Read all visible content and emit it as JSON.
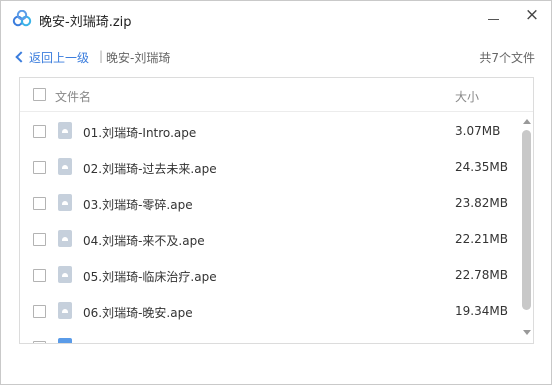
{
  "window": {
    "title": "晚安-刘瑞琦.zip",
    "close_glyph": "×"
  },
  "nav": {
    "back_label": "返回上一级",
    "separator": "|",
    "current_folder": "晚安-刘瑞琦",
    "file_count": "共7个文件"
  },
  "list": {
    "columns": {
      "name": "文件名",
      "size": "大小"
    },
    "files": [
      {
        "name": "01.刘瑞琦-Intro.ape",
        "size": "3.07MB"
      },
      {
        "name": "02.刘瑞琦-过去未来.ape",
        "size": "24.35MB"
      },
      {
        "name": "03.刘瑞琦-零碎.ape",
        "size": "23.82MB"
      },
      {
        "name": "04.刘瑞琦-来不及.ape",
        "size": "22.21MB"
      },
      {
        "name": "05.刘瑞琦-临床治疗.ape",
        "size": "22.78MB"
      },
      {
        "name": "06.刘瑞琦-晚安.ape",
        "size": "19.34MB"
      }
    ]
  },
  "colors": {
    "accent": "#3b7ddd",
    "folder_icon": "#5a9be8",
    "file_icon": "#c6d0dc"
  },
  "icons": {
    "app": "cloud-logo-icon",
    "file": "audio-file-icon",
    "folder": "folder-icon",
    "back": "chevron-left-icon"
  }
}
